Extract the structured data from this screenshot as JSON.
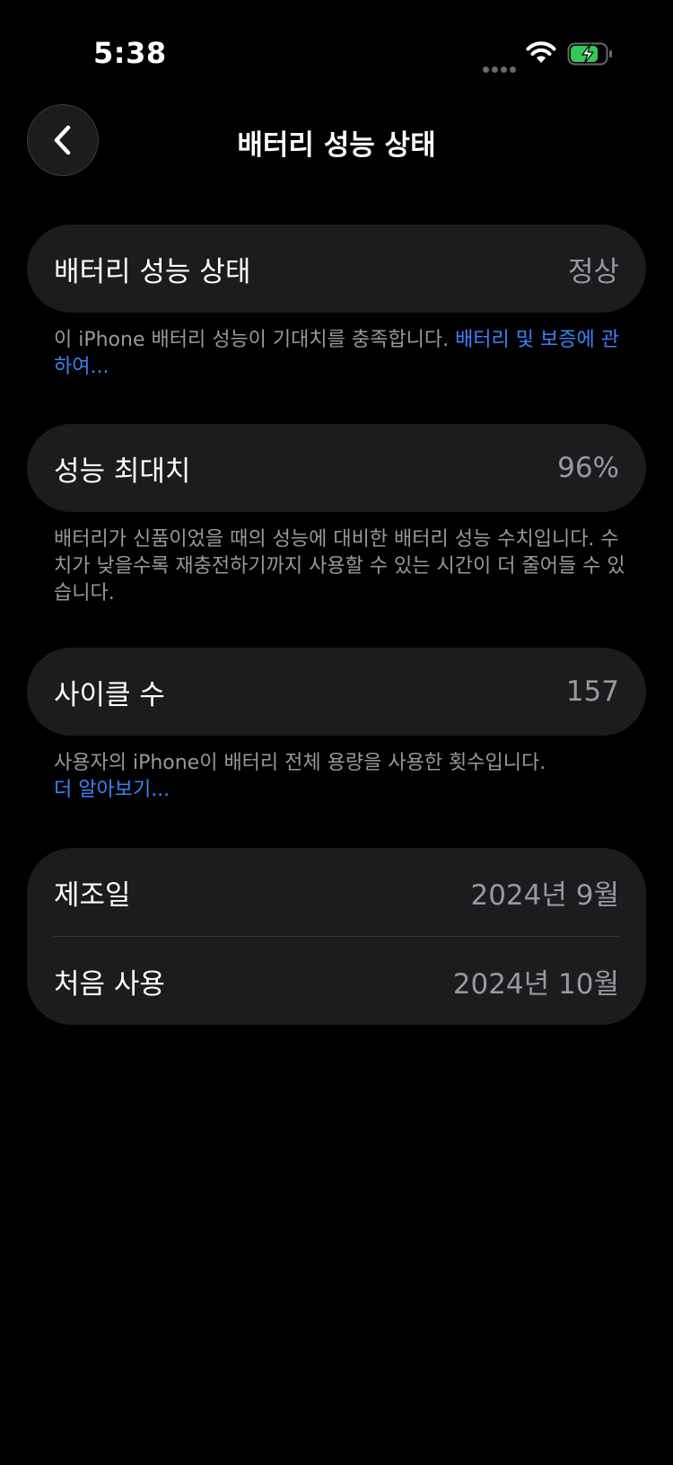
{
  "status": {
    "time": "5:38"
  },
  "nav": {
    "title": "배터리 성능 상태"
  },
  "health": {
    "label": "배터리 성능 상태",
    "value": "정상",
    "note": "이 iPhone 배터리 성능이 기대치를 충족합니다. ",
    "link": "배터리 및 보증에 관하여..."
  },
  "capacity": {
    "label": "성능 최대치",
    "value": "96%",
    "note": "배터리가 신품이었을 때의 성능에 대비한 배터리 성능 수치입니다. 수치가 낮을수록 재충전하기까지 사용할 수 있는 시간이 더 줄어들 수 있습니다."
  },
  "cycles": {
    "label": "사이클 수",
    "value": "157",
    "note": "사용자의 iPhone이 배터리 전체 용량을 사용한 횟수입니다.",
    "link": "더 알아보기..."
  },
  "dates": {
    "manufactured_label": "제조일",
    "manufactured_value": "2024년 9월",
    "first_use_label": "처음 사용",
    "first_use_value": "2024년 10월"
  },
  "colors": {
    "link": "#3b82f6",
    "battery_fill": "#34c759"
  }
}
